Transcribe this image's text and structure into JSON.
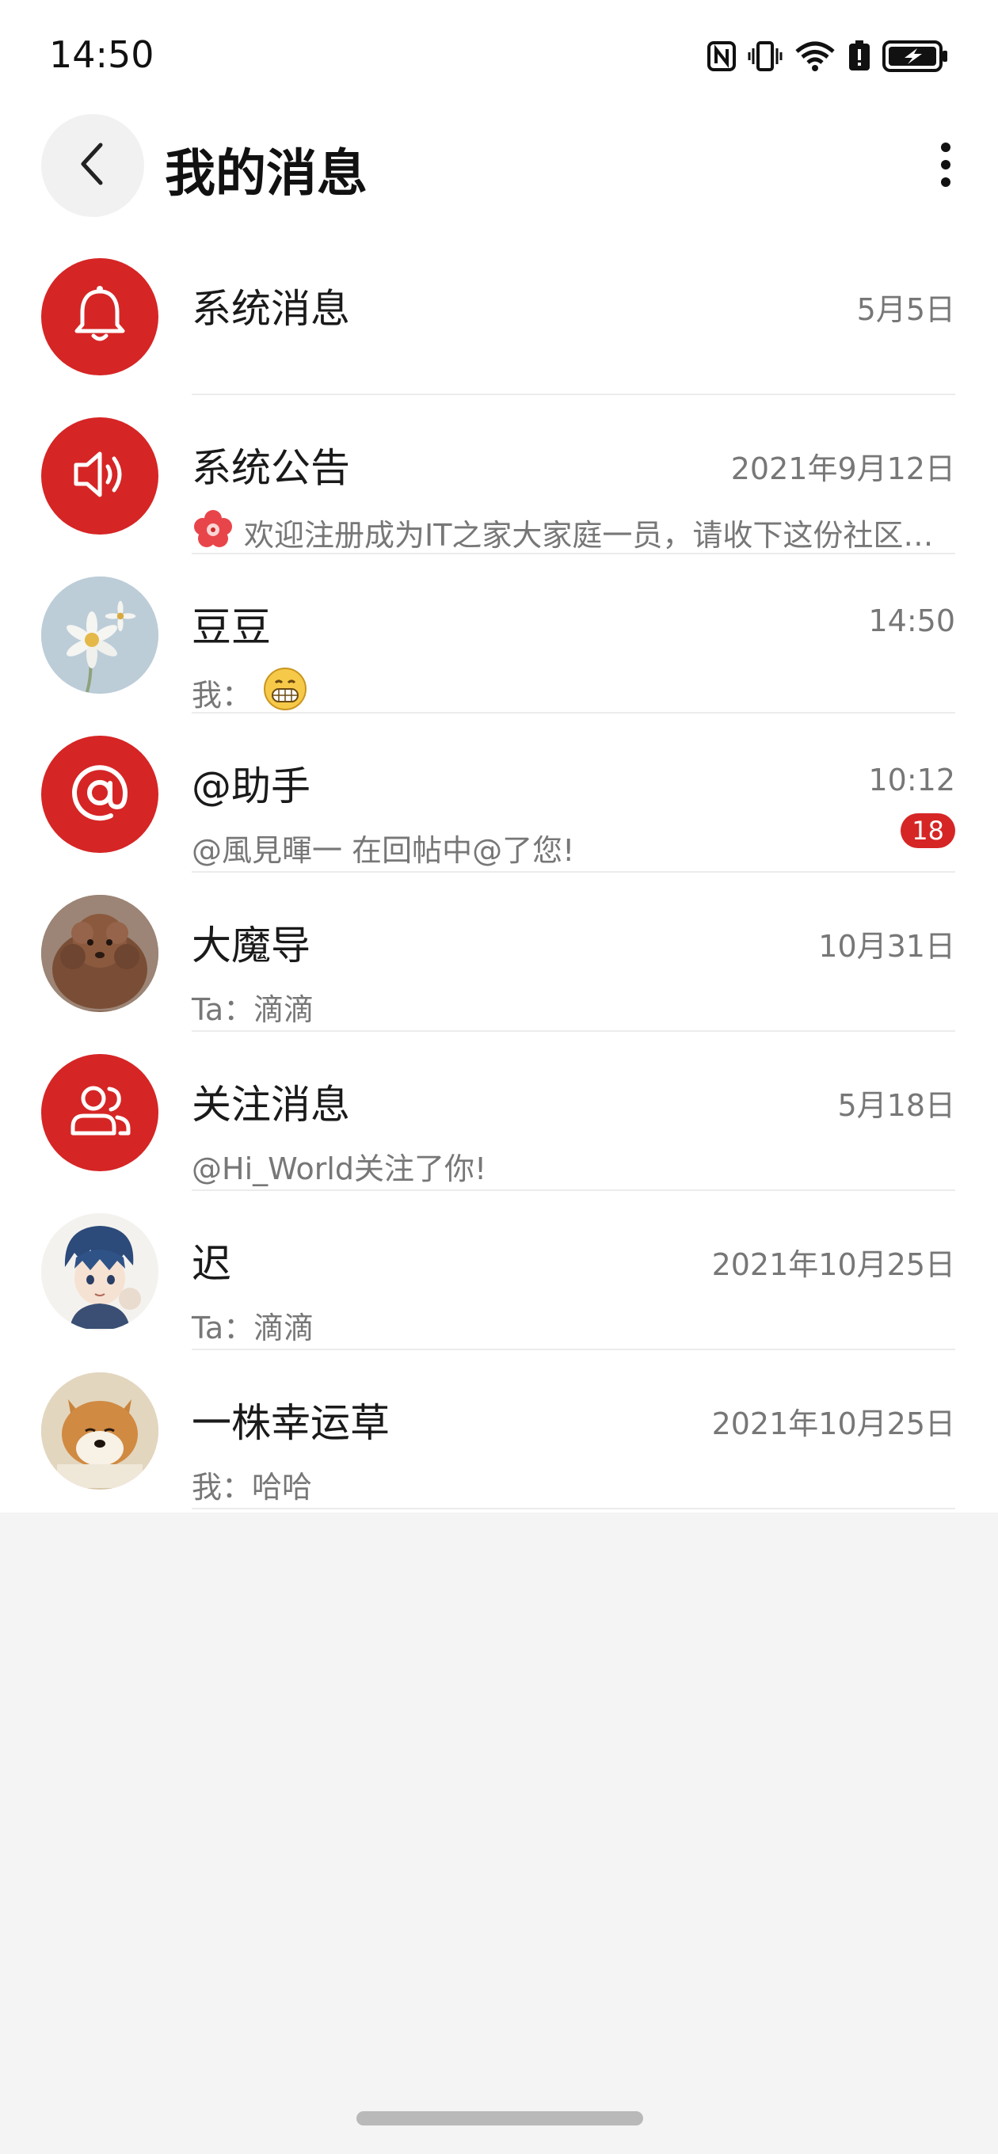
{
  "status_bar": {
    "time": "14:50",
    "icons": [
      "nfc-icon",
      "vibrate-icon",
      "wifi-icon",
      "battery-alert-icon",
      "battery-charging-icon"
    ]
  },
  "header": {
    "back_icon": "chevron-left-icon",
    "title": "我的消息",
    "more_icon": "more-vertical-icon"
  },
  "colors": {
    "accent": "#d62525",
    "muted_text": "#777777",
    "divider": "#ececec",
    "background": "#f4f4f4"
  },
  "messages": [
    {
      "name": "系统消息",
      "time": "5月5日",
      "preview": "",
      "avatar_icon": "bell-icon"
    },
    {
      "name": "系统公告",
      "time": "2021年9月12日",
      "preview": "欢迎注册成为IT之家大家庭一员，请收下这份社区…",
      "avatar_icon": "speaker-icon",
      "preview_icon": "flower-icon"
    },
    {
      "name": "豆豆",
      "time": "14:50",
      "preview": "我：",
      "avatar_icon": "daisy-photo",
      "preview_icon": "grin-emoji-icon"
    },
    {
      "name": "@助手",
      "time": "10:12",
      "preview": "@風見暉一 在回帖中@了您!",
      "avatar_icon": "at-icon",
      "badge": "18"
    },
    {
      "name": "大魔导",
      "time": "10月31日",
      "preview": "Ta：滴滴",
      "avatar_icon": "poodle-photo"
    },
    {
      "name": "关注消息",
      "time": "5月18日",
      "preview": "@Hi_World关注了你!",
      "avatar_icon": "users-icon"
    },
    {
      "name": "迟",
      "time": "2021年10月25日",
      "preview": "Ta：滴滴",
      "avatar_icon": "anime-character-photo"
    },
    {
      "name": "一株幸运草",
      "time": "2021年10月25日",
      "preview": "我：哈哈",
      "avatar_icon": "shiba-dog-photo"
    }
  ]
}
